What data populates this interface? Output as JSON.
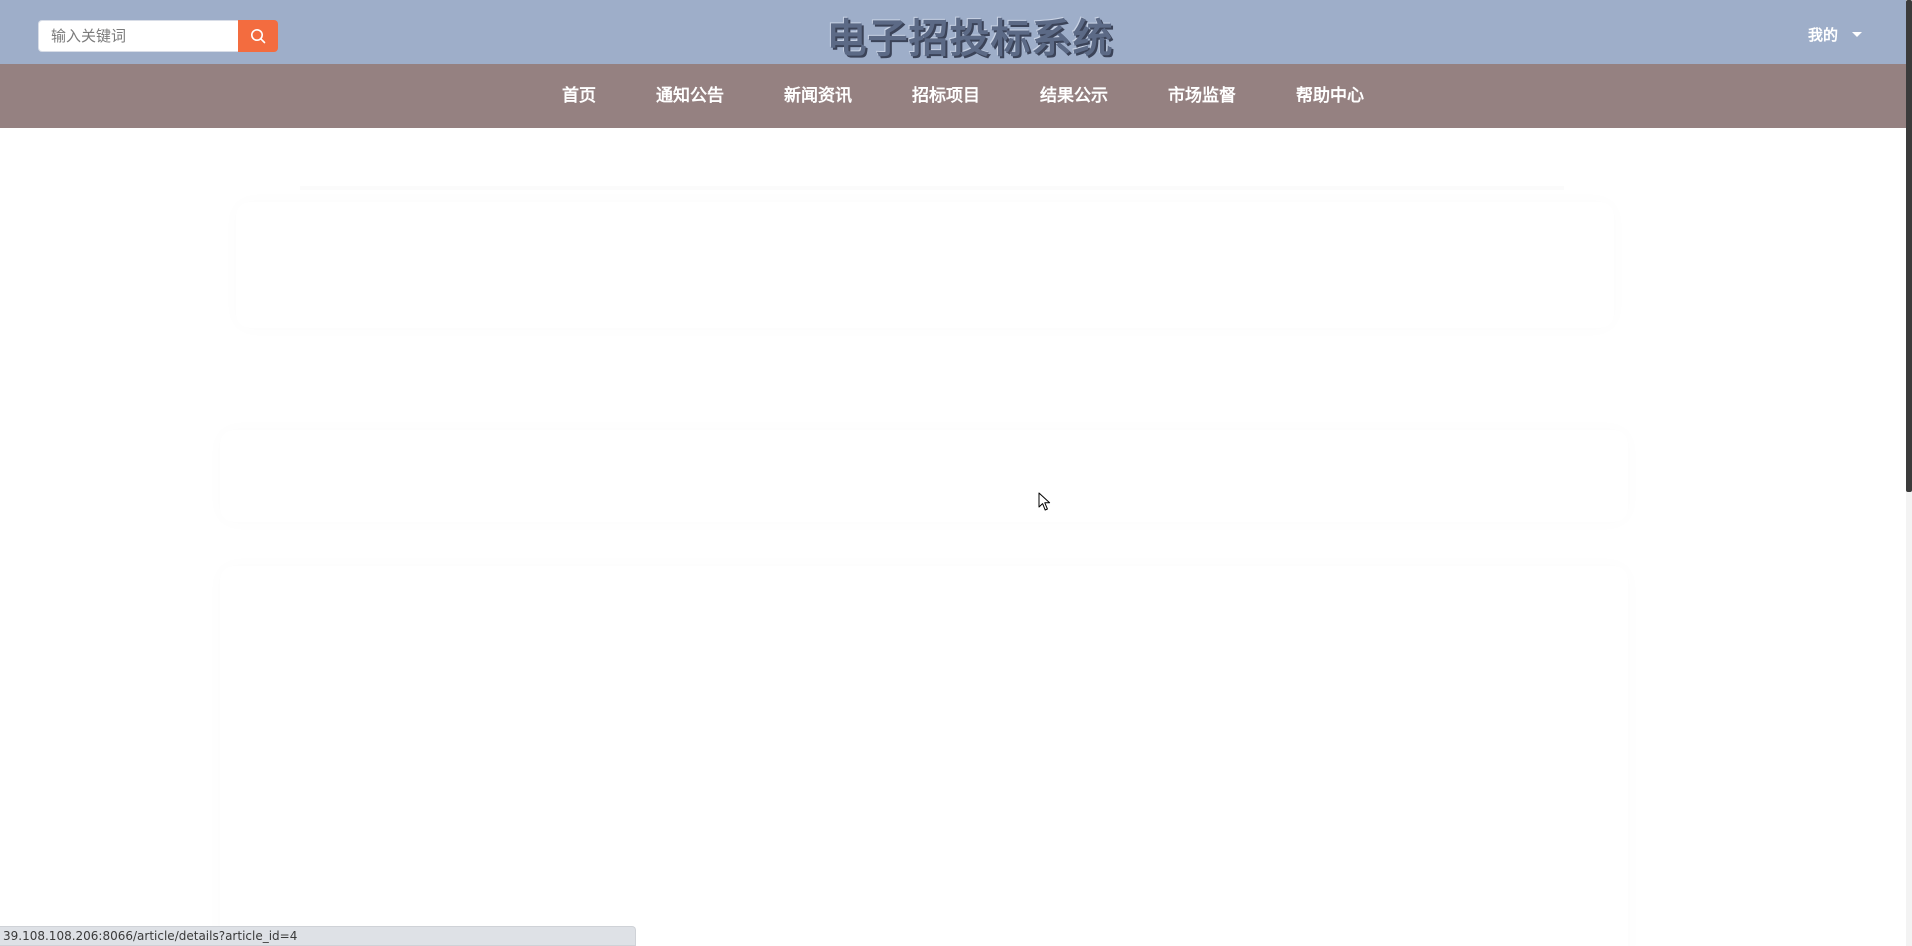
{
  "header": {
    "search": {
      "placeholder": "输入关键词",
      "value": ""
    },
    "search_button_icon": "search-icon",
    "site_title": "电子招投标系统",
    "user_menu": {
      "label": "我的",
      "icon": "caret-down-icon"
    }
  },
  "nav": {
    "items": [
      {
        "label": "首页"
      },
      {
        "label": "通知公告"
      },
      {
        "label": "新闻资讯"
      },
      {
        "label": "招标项目"
      },
      {
        "label": "结果公示"
      },
      {
        "label": "市场监督"
      },
      {
        "label": "帮助中心"
      }
    ]
  },
  "status_bar": {
    "url": "39.108.108.206:8066/article/details?article_id=4"
  },
  "colors": {
    "header_bg": "#9eaec9",
    "nav_bg": "#958181",
    "search_button": "#f36c3f",
    "title": "#5c6a86"
  }
}
